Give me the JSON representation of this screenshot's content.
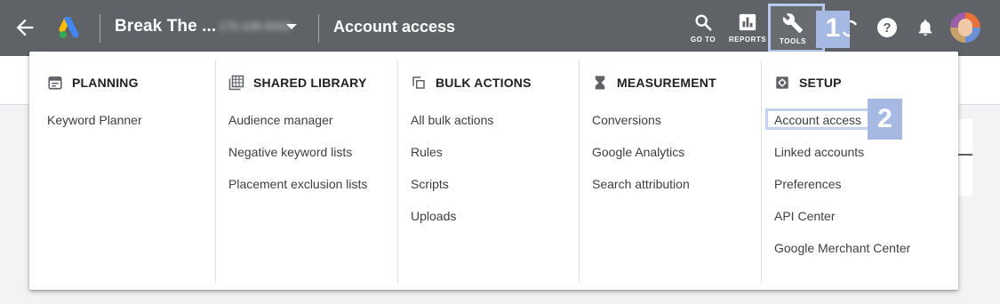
{
  "topbar": {
    "account_name": "Break The ...",
    "account_id": "170-106-0002",
    "page_title": "Account access",
    "tools": [
      {
        "icon": "search-icon",
        "label": "GO TO"
      },
      {
        "icon": "bar-chart-icon",
        "label": "REPORTS"
      },
      {
        "icon": "wrench-icon",
        "label": "TOOLS"
      }
    ],
    "annotation_1": "1"
  },
  "menu": {
    "columns": [
      {
        "icon": "calendar-icon",
        "title": "PLANNING",
        "items": [
          "Keyword Planner"
        ]
      },
      {
        "icon": "library-icon",
        "title": "SHARED LIBRARY",
        "items": [
          "Audience manager",
          "Negative keyword lists",
          "Placement exclusion lists"
        ]
      },
      {
        "icon": "bulk-copy-icon",
        "title": "BULK ACTIONS",
        "items": [
          "All bulk actions",
          "Rules",
          "Scripts",
          "Uploads"
        ]
      },
      {
        "icon": "hourglass-icon",
        "title": "MEASUREMENT",
        "items": [
          "Conversions",
          "Google Analytics",
          "Search attribution"
        ]
      },
      {
        "icon": "settings-icon",
        "title": "SETUP",
        "items": [
          "Account access",
          "Linked accounts",
          "Preferences",
          "API Center",
          "Google Merchant Center"
        ]
      }
    ],
    "annotation_2": "2"
  },
  "colors": {
    "topbar": "#5f6368",
    "annotation": "#a6b9e3"
  }
}
